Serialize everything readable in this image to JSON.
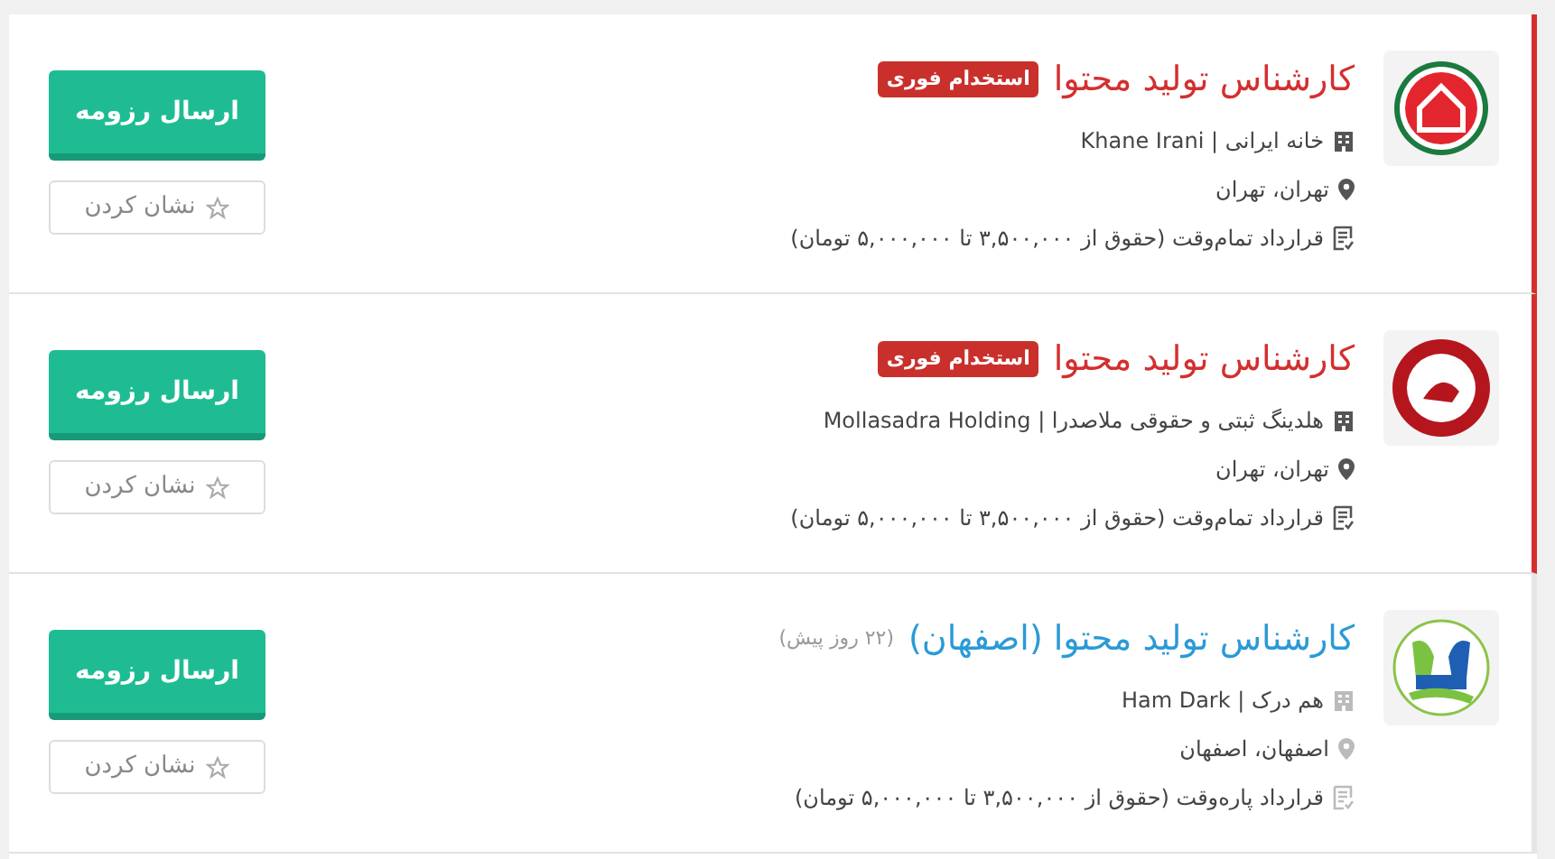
{
  "jobs": [
    {
      "title": "کارشناس تولید محتوا",
      "urgent": true,
      "badge": "استخدام فوری",
      "company": "خانه ایرانی | Khane Irani",
      "location": "تهران، تهران",
      "contract": "قرارداد تمام‌وقت (حقوق از ۳,۵۰۰,۰۰۰ تا ۵,۰۰۰,۰۰۰ تومان)",
      "apply": "ارسال رزومه",
      "bookmark": "نشان کردن"
    },
    {
      "title": "کارشناس تولید محتوا",
      "urgent": true,
      "badge": "استخدام فوری",
      "company": "هلدینگ ثبتی و حقوقی ملاصدرا | Mollasadra Holding",
      "location": "تهران، تهران",
      "contract": "قرارداد تمام‌وقت (حقوق از ۳,۵۰۰,۰۰۰ تا ۵,۰۰۰,۰۰۰ تومان)",
      "apply": "ارسال رزومه",
      "bookmark": "نشان کردن"
    },
    {
      "title": "کارشناس تولید محتوا (اصفهان)",
      "urgent": false,
      "posted": "(۲۲ روز پیش)",
      "company": "هم درک | Ham Dark",
      "location": "اصفهان، اصفهان",
      "contract": "قرارداد پاره‌وقت (حقوق از ۳,۵۰۰,۰۰۰ تا ۵,۰۰۰,۰۰۰ تومان)",
      "apply": "ارسال رزومه",
      "bookmark": "نشان کردن"
    }
  ]
}
